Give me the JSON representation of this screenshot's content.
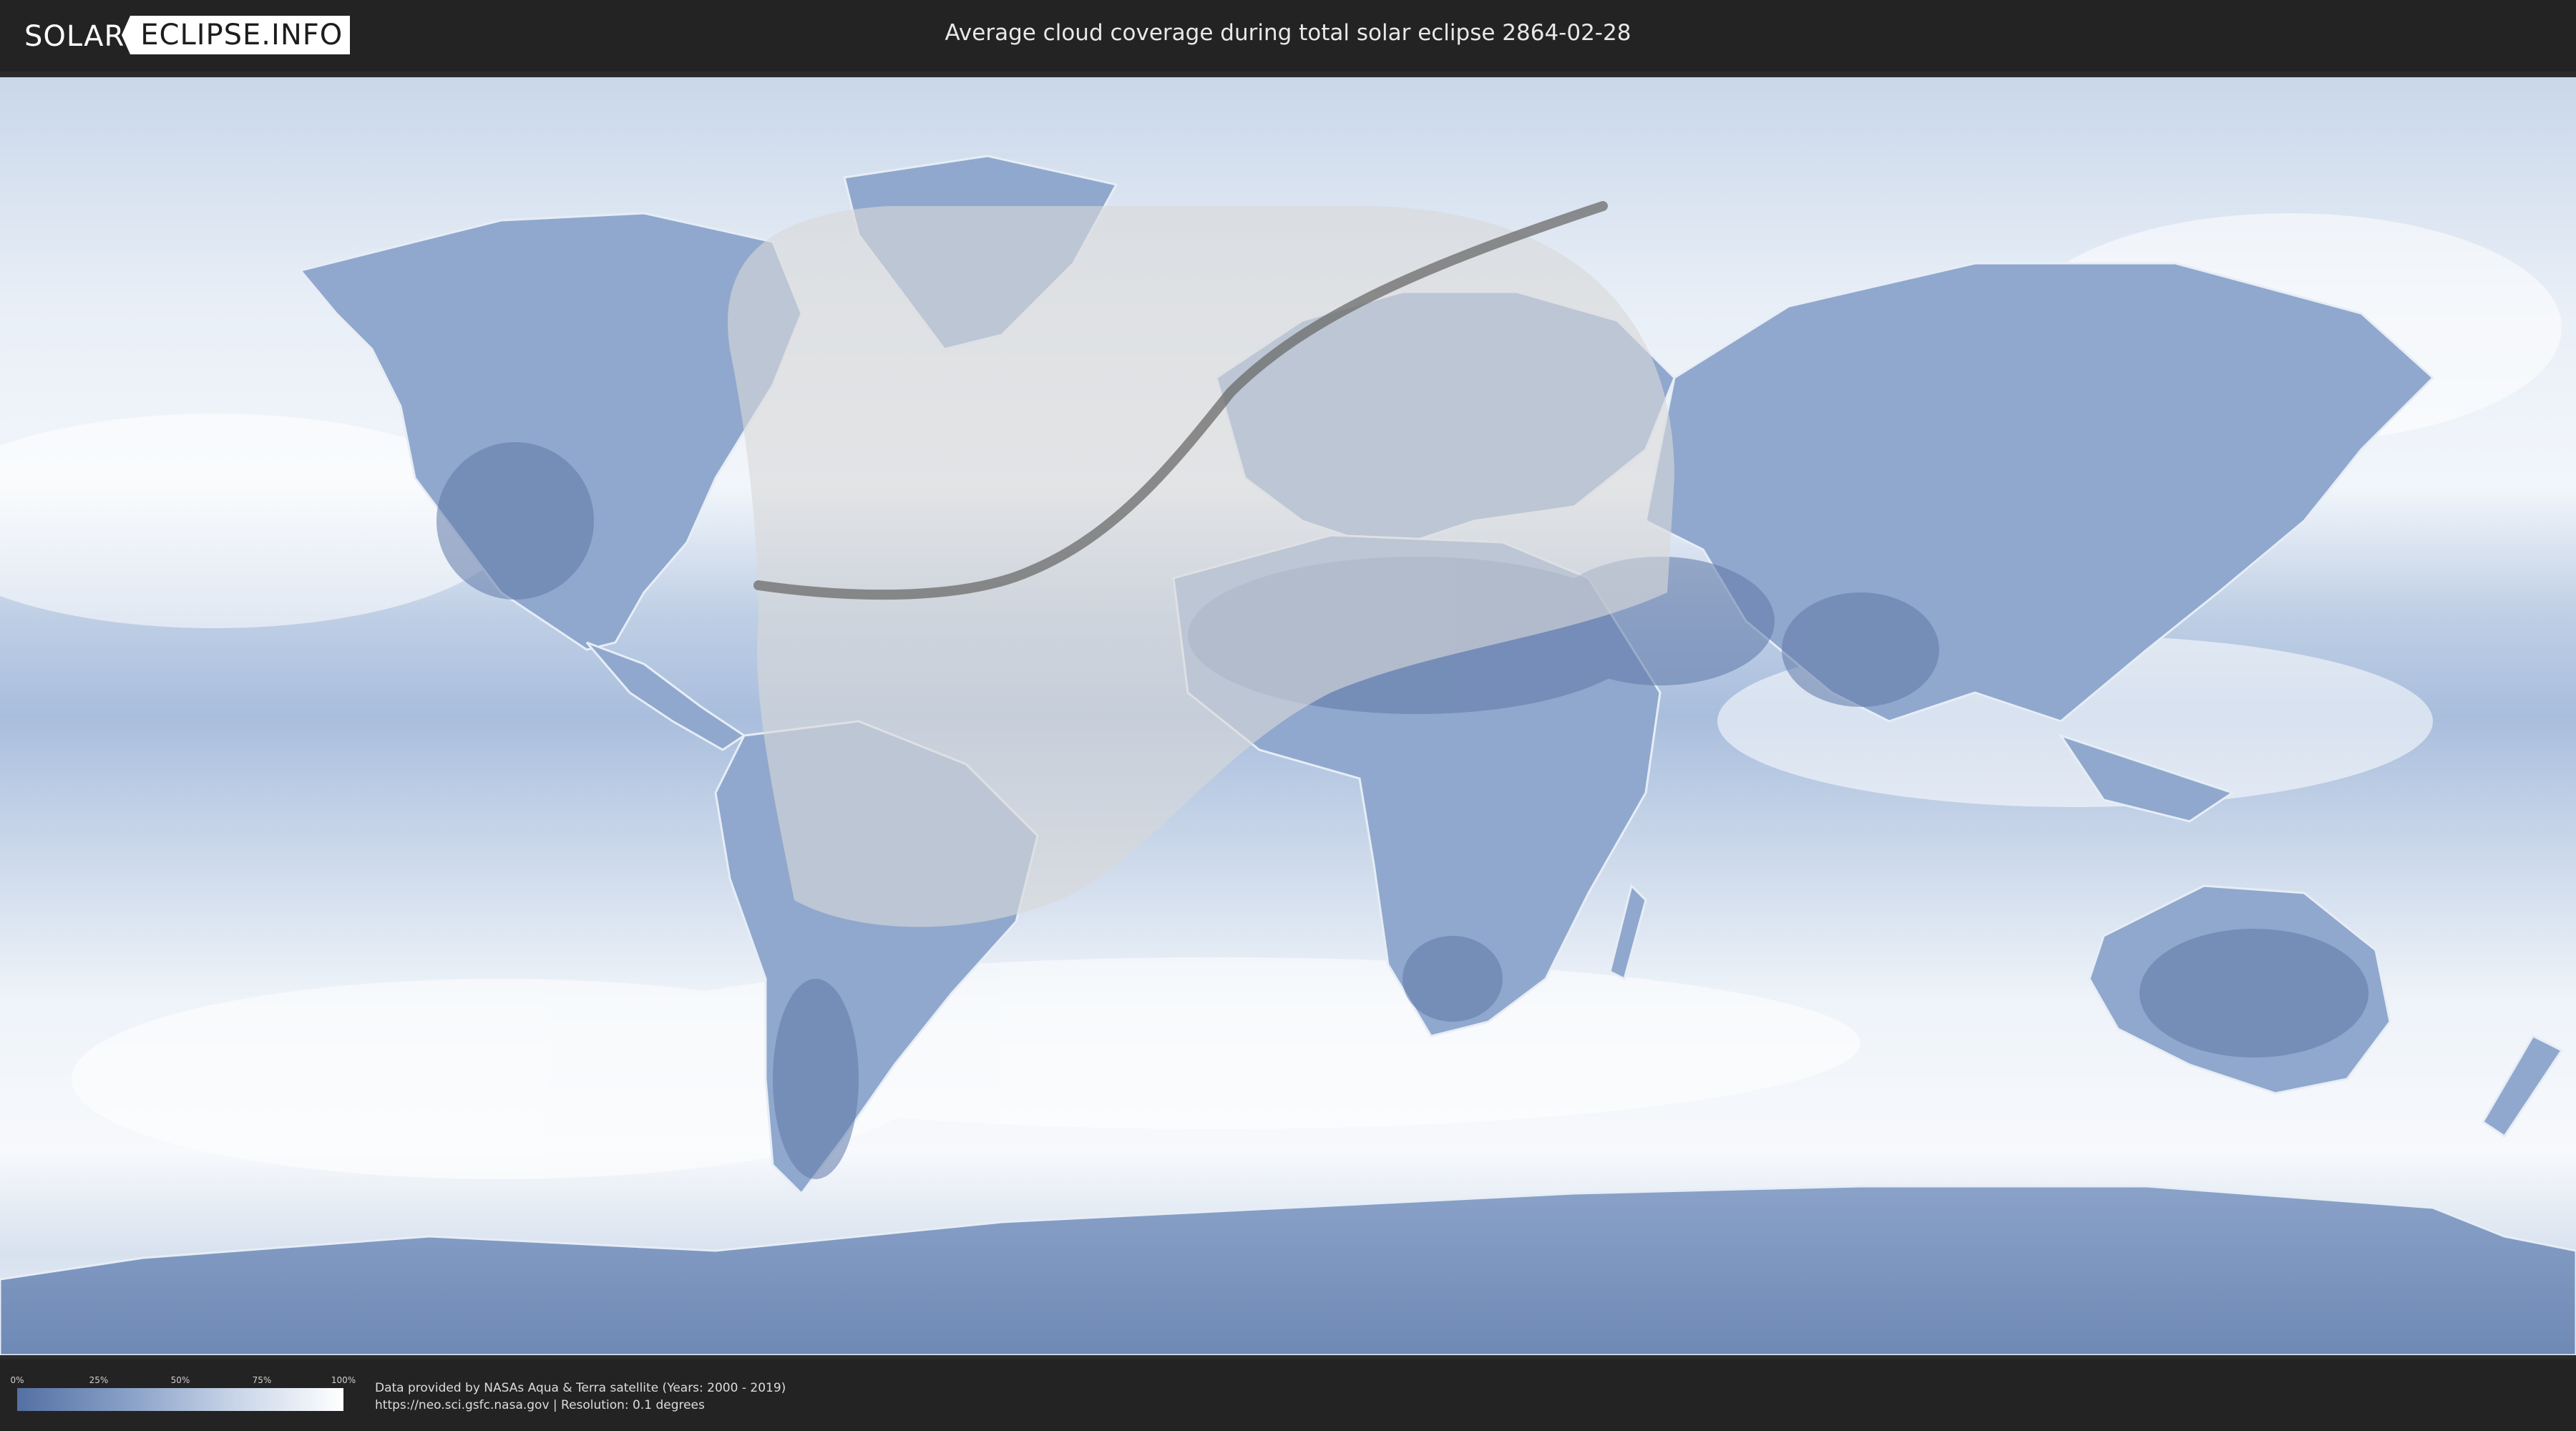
{
  "header": {
    "logo_left": "SOLAR",
    "logo_right": "ECLIPSE.INFO",
    "title": "Average cloud coverage during total solar eclipse 2864-02-28"
  },
  "map": {
    "description_layer": "cloud-coverage-world-map",
    "colors": {
      "ocean_clear": "#9fb6d8",
      "cloudy": "#f4f7fb",
      "land_clear": "#5f78a8",
      "eclipse_overlay": "#d9d9d9",
      "eclipse_path": "#6b6b6b"
    }
  },
  "legend": {
    "ticks": [
      "0%",
      "25%",
      "50%",
      "75%",
      "100%"
    ],
    "tick_fractions": [
      0,
      0.25,
      0.5,
      0.75,
      1.0
    ],
    "gradient_from": "#5470a3",
    "gradient_to": "#ffffff"
  },
  "footer": {
    "line1": "Data provided by NASAs Aqua & Terra satellite (Years: 2000 - 2019)",
    "line2": "https://neo.sci.gsfc.nasa.gov | Resolution: 0.1 degrees"
  }
}
